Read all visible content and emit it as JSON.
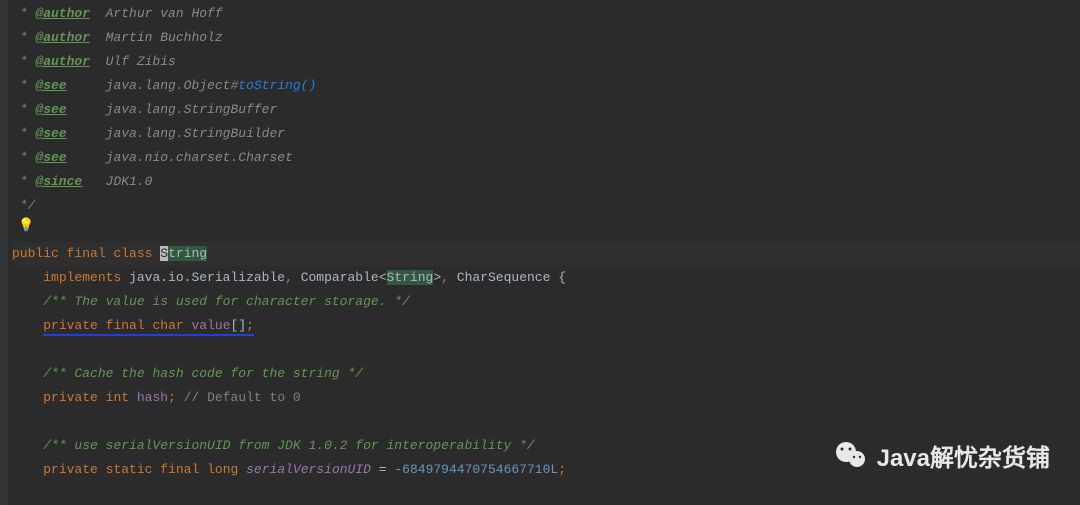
{
  "doc": {
    "author_tag": "@author",
    "see_tag": "@see",
    "since_tag": "@since",
    "author1": "Arthur van Hoff",
    "author2": "Martin Buchholz",
    "author3": "Ulf Zibis",
    "see1_prefix": "java.lang.Object#",
    "see1_link": "toString()",
    "see2": "java.lang.StringBuffer",
    "see3": "java.lang.StringBuilder",
    "see4": "java.nio.charset.Charset",
    "since_val": "JDK1.0",
    "star": " *",
    "star_sp": " * ",
    "end": " */"
  },
  "code": {
    "public": "public",
    "final": "final",
    "class": "class",
    "String_S": "S",
    "String_rest": "tring",
    "implements": "implements",
    "serializable": "java.io.Serializable",
    "comma": ",",
    "comparable": "Comparable",
    "lt": "<",
    "String2": "String",
    "gt": ">",
    "charseq": "CharSequence",
    "brace": "{",
    "comment_value": "/** The value is used for character storage. */",
    "private": "private",
    "char": "char",
    "value": "value",
    "brackets": "[]",
    "semi": ";",
    "comment_hash": "/** Cache the hash code for the string */",
    "int": "int",
    "hash": "hash",
    "line_comment": "// ",
    "default0": "Default to 0",
    "comment_suid": "/** use serialVersionUID from JDK 1.0.2 for interoperability */",
    "static": "static",
    "long": "long",
    "suid": "serialVersionUID",
    "eq": " = ",
    "suid_val": "-6849794470754667710L"
  },
  "watermark": {
    "text": "Java解忧杂货铺"
  },
  "bulb": "💡"
}
